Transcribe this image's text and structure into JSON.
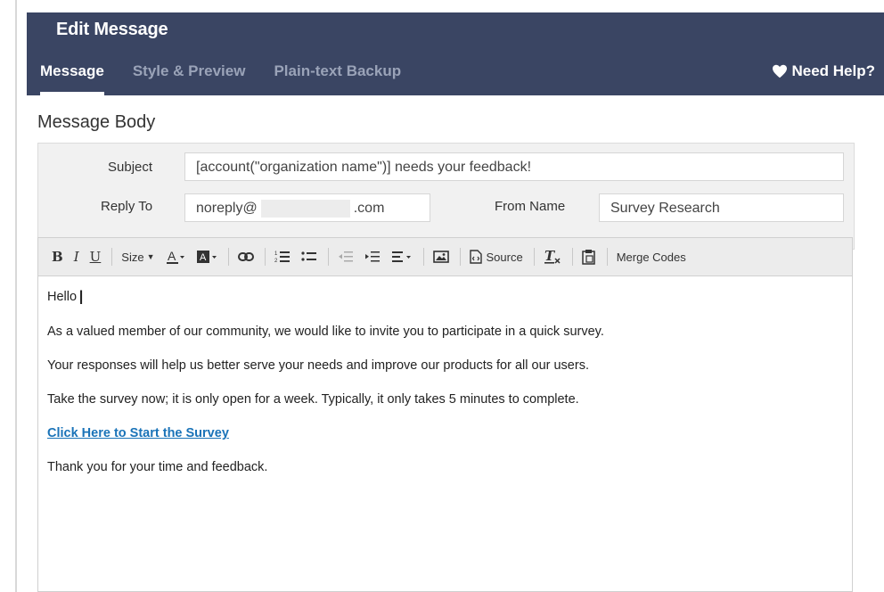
{
  "header": {
    "title": "Edit Message",
    "help_label": "Need Help?"
  },
  "tabs": [
    {
      "label": "Message",
      "active": true
    },
    {
      "label": "Style & Preview",
      "active": false
    },
    {
      "label": "Plain-text Backup",
      "active": false
    }
  ],
  "section": {
    "title": "Message Body"
  },
  "form": {
    "subject_label": "Subject",
    "subject_value": "[account(\"organization name\")] needs your feedback!",
    "reply_to_label": "Reply To",
    "reply_to_prefix": "noreply@",
    "reply_to_suffix": ".com",
    "from_name_label": "From Name",
    "from_name_value": "Survey Research"
  },
  "toolbar": {
    "bold": "B",
    "italic": "I",
    "underline": "U",
    "size_label": "Size",
    "source_label": "Source",
    "merge_codes_label": "Merge Codes"
  },
  "editor": {
    "greeting": "Hello",
    "para1": "As a valued member of our community, we would like to invite you to participate in a quick survey.",
    "para2": "Your responses will help us better serve your needs and improve our products for all our users.",
    "para3": "Take the survey now; it is only open for a week. Typically, it only takes 5 minutes to complete.",
    "link_text": "Click Here to Start the Survey",
    "closing": "Thank you for your time and feedback."
  },
  "colors": {
    "header_bg": "#3a4563",
    "link": "#1a73b8"
  }
}
